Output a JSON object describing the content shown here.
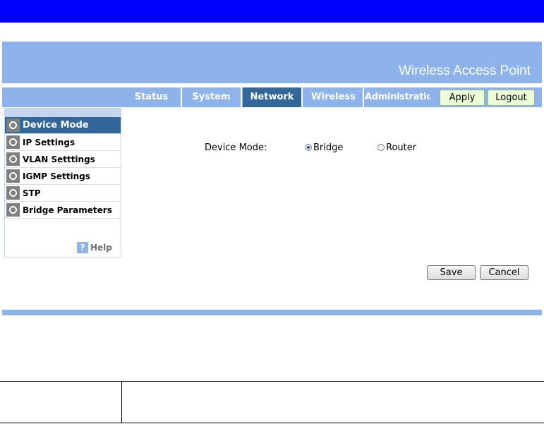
{
  "header": {
    "brand": "Wireless Access Point"
  },
  "nav": {
    "tabs": [
      {
        "label": "Status",
        "active": false
      },
      {
        "label": "System",
        "active": false
      },
      {
        "label": "Network",
        "active": true
      },
      {
        "label": "Wireless",
        "active": false
      },
      {
        "label": "Administration",
        "active": false
      }
    ],
    "apply_label": "Apply",
    "logout_label": "Logout"
  },
  "sidebar": {
    "items": [
      {
        "label": "Device Mode",
        "active": true
      },
      {
        "label": "IP Settings",
        "active": false
      },
      {
        "label": "VLAN Setttings",
        "active": false
      },
      {
        "label": "IGMP Settings",
        "active": false
      },
      {
        "label": "STP",
        "active": false
      },
      {
        "label": "Bridge Parameters",
        "active": false
      }
    ],
    "help_icon": "?",
    "help_label": "Help"
  },
  "content": {
    "device_mode_label": "Device Mode:",
    "options": [
      {
        "label": "Bridge",
        "checked": true
      },
      {
        "label": "Router",
        "checked": false
      }
    ],
    "save_label": "Save",
    "cancel_label": "Cancel"
  },
  "colors": {
    "topbar": "#0000ff",
    "banner": "#8eb2ea",
    "active_tab": "#336699",
    "button_green": "#ecffd6"
  }
}
